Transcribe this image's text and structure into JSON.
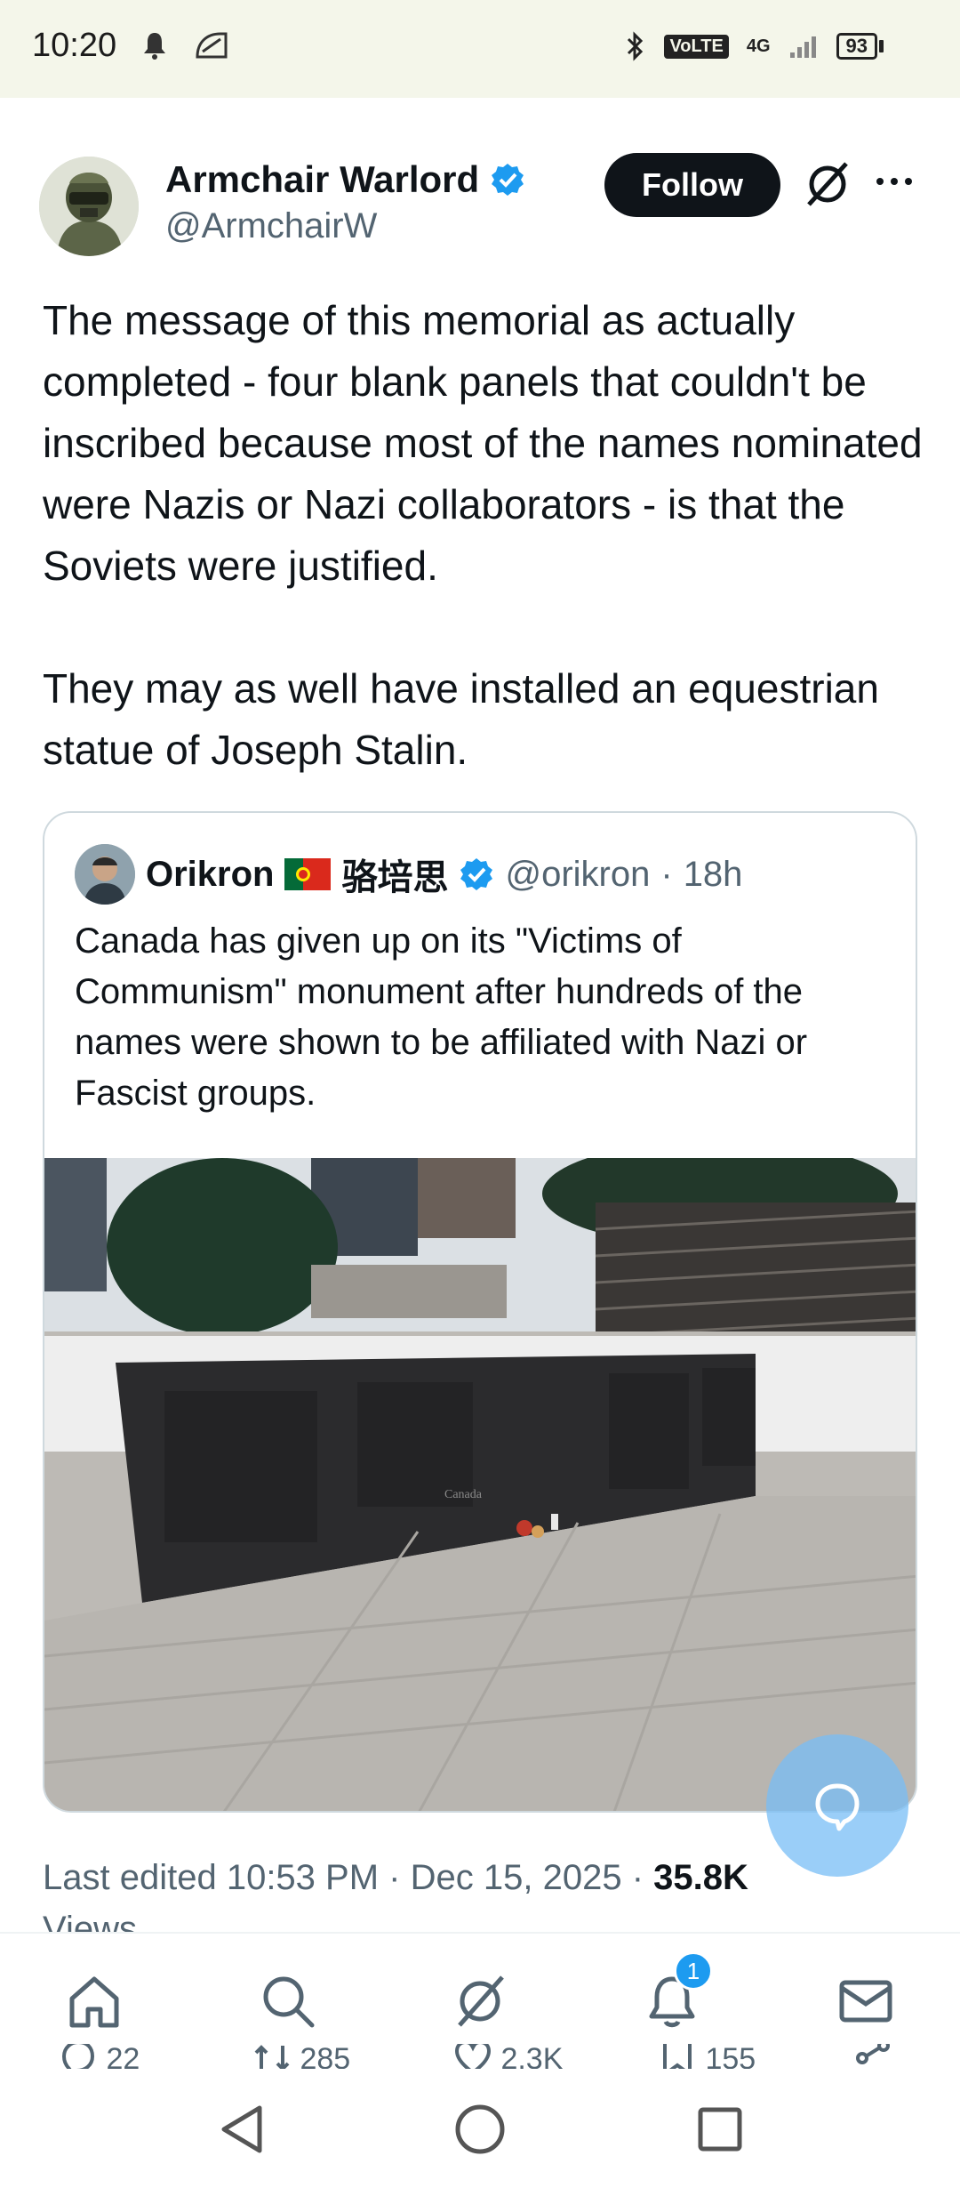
{
  "status_bar": {
    "time": "10:20",
    "network": "4G",
    "volte": "VoLTE",
    "battery": "93"
  },
  "tweet": {
    "author_name": "Armchair Warlord",
    "author_handle": "@ArmchairW",
    "follow_label": "Follow",
    "text": "The message of this memorial as actually completed - four blank panels that couldn't be inscribed because most of the names nominated were Nazis or Nazi collaborators - is that the Soviets were justified.\n\nThey may as well have installed an equestrian statue of Joseph Stalin.",
    "edited_label": "Last edited",
    "time": "10:53 PM",
    "date": "Dec 15, 2025",
    "views_count": "35.8K",
    "views_label": "Views"
  },
  "quote": {
    "name": "Orikron",
    "name_cjk": "骆培思",
    "handle": "@orikron",
    "age": "18h",
    "text": "Canada has given up on its \"Victims of Communism\" monument after hundreds of the names were shown to be affiliated with Nazi or Fascist groups.",
    "image_engraving": "Canada"
  },
  "action_counts": {
    "replies": "22",
    "reposts": "285",
    "likes": "2.3K",
    "bookmarks": "155"
  },
  "bottom_nav": {
    "notifications_badge": "1"
  },
  "colors": {
    "accent": "#1d9bf0",
    "text": "#0f1419",
    "muted": "#536471",
    "follow_bg": "#0f1419"
  }
}
